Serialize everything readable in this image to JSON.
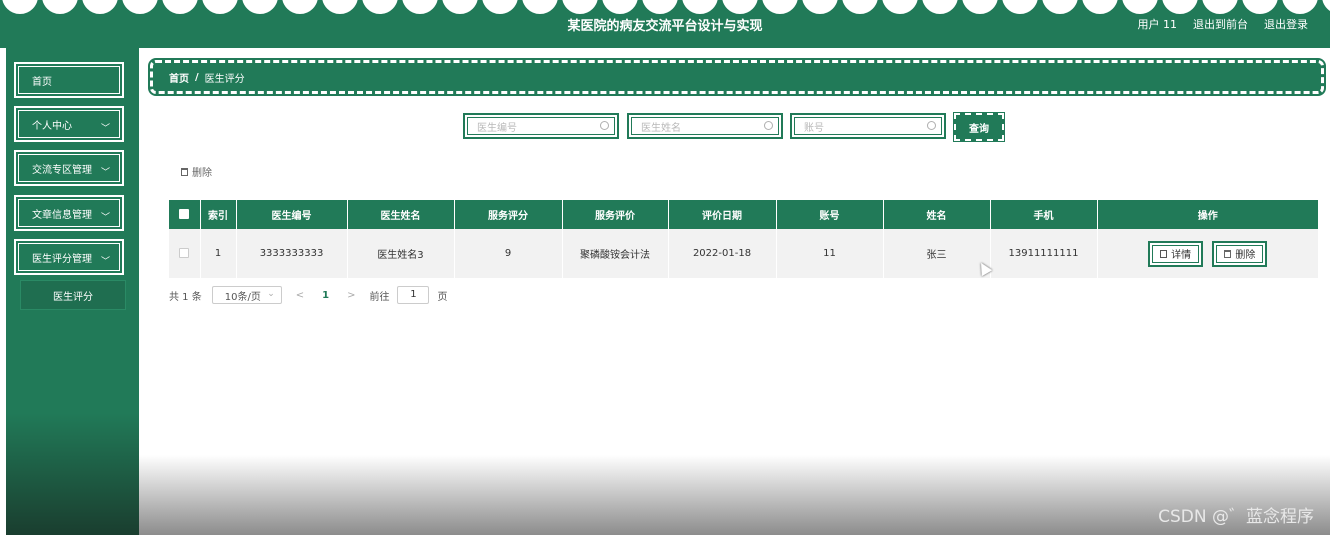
{
  "header": {
    "title": "某医院的病友交流平台设计与实现",
    "user": "用户 11",
    "back_front": "退出到前台",
    "logout": "退出登录"
  },
  "sidebar": {
    "items": [
      {
        "label": "首页",
        "has_chevron": false
      },
      {
        "label": "个人中心",
        "has_chevron": true
      },
      {
        "label": "交流专区管理",
        "has_chevron": true
      },
      {
        "label": "文章信息管理",
        "has_chevron": true
      },
      {
        "label": "医生评分管理",
        "has_chevron": true
      }
    ],
    "submenu": {
      "label": "医生评分"
    },
    "chevron": "﹀"
  },
  "breadcrumb": {
    "home": "首页",
    "separator": "/",
    "current": "医生评分"
  },
  "search": {
    "doctor_no_placeholder": "医生编号",
    "doctor_name_placeholder": "医生姓名",
    "account_placeholder": "账号",
    "button": "查询"
  },
  "toolbar": {
    "delete": "删除"
  },
  "table": {
    "headers": [
      "",
      "索引",
      "医生编号",
      "医生姓名",
      "服务评分",
      "服务评价",
      "评价日期",
      "账号",
      "姓名",
      "手机",
      "操作"
    ],
    "rows": [
      {
        "index": "1",
        "doctor_no": "3333333333",
        "doctor_name": "医生姓名3",
        "score": "9",
        "comment": "聚磷酸铵会计法",
        "date": "2022-01-18",
        "account": "11",
        "name": "张三",
        "phone": "13911111111",
        "detail": "详情",
        "delete": "删除"
      }
    ]
  },
  "pagination": {
    "total": "共 1 条",
    "page_size": "10条/页",
    "prev": "<",
    "current": "1",
    "next": ">",
    "goto_label": "前往",
    "goto_value": "1",
    "page_unit": "页"
  },
  "watermark": "CSDN @゛蓝念程序",
  "colors": {
    "primary": "#217a58",
    "white": "#ffffff"
  }
}
